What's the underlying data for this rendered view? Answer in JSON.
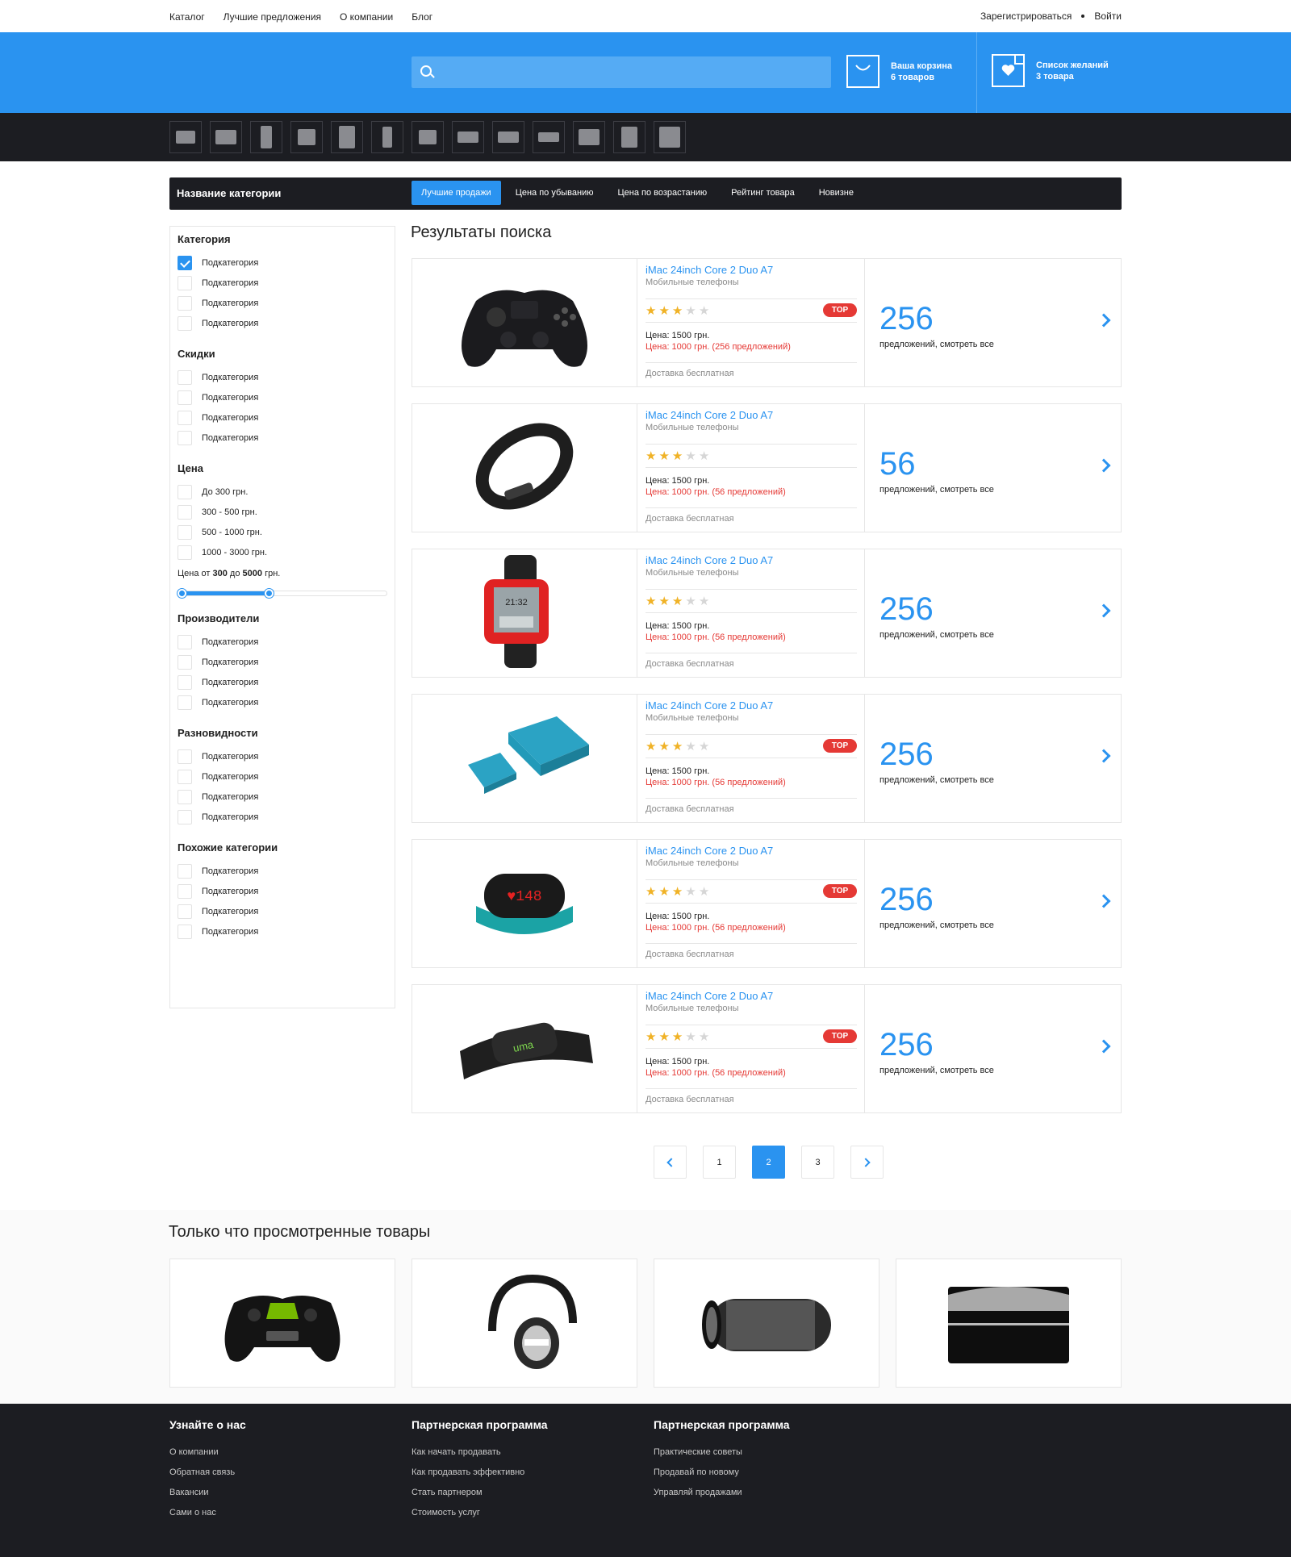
{
  "topnav": {
    "links": [
      "Каталог",
      "Лучшие предложения",
      "О компании",
      "Блог"
    ],
    "register": "Зарегистрироваться",
    "login": "Войти"
  },
  "header": {
    "search": {
      "value": "",
      "placeholder": ""
    },
    "cart": {
      "title": "Ваша корзина",
      "count": "6 товаров"
    },
    "wishlist": {
      "title": "Список желаний",
      "count": "3 товара"
    }
  },
  "categories": [
    "camera",
    "monitor",
    "fridge",
    "washbasin",
    "wardrobe",
    "bottle",
    "printer",
    "gamepad",
    "car",
    "router",
    "piano",
    "kitchenware",
    "books"
  ],
  "sortbar": {
    "title": "Название категории",
    "tabs": [
      "Лучшие продажи",
      "Цена по убыванию",
      "Цена по возрастанию",
      "Рейтинг товара",
      "Новизне"
    ],
    "active_tab": 0
  },
  "filters": {
    "groups": [
      {
        "title": "Категория",
        "items": [
          {
            "label": "Подкатегория",
            "checked": true
          },
          {
            "label": "Подкатегория",
            "checked": false
          },
          {
            "label": "Подкатегория",
            "checked": false
          },
          {
            "label": "Подкатегория",
            "checked": false
          }
        ]
      },
      {
        "title": "Скидки",
        "items": [
          {
            "label": "Подкатегория",
            "checked": false
          },
          {
            "label": "Подкатегория",
            "checked": false
          },
          {
            "label": "Подкатегория",
            "checked": false
          },
          {
            "label": "Подкатегория",
            "checked": false
          }
        ]
      },
      {
        "title": "Цена",
        "items": [
          {
            "label": "До 300 грн.",
            "checked": false
          },
          {
            "label": "300 - 500 грн.",
            "checked": false
          },
          {
            "label": "500 - 1000 грн.",
            "checked": false
          },
          {
            "label": "1000 - 3000 грн.",
            "checked": false
          }
        ],
        "range": {
          "prefix": "Цена от",
          "from": "300",
          "mid": "до",
          "to": "5000",
          "suffix": "грн.",
          "from_frac": 0.0,
          "to_frac": 0.42
        }
      },
      {
        "title": "Производители",
        "items": [
          {
            "label": "Подкатегория",
            "checked": false
          },
          {
            "label": "Подкатегория",
            "checked": false
          },
          {
            "label": "Подкатегория",
            "checked": false
          },
          {
            "label": "Подкатегория",
            "checked": false
          }
        ]
      },
      {
        "title": "Разновидности",
        "items": [
          {
            "label": "Подкатегория",
            "checked": false
          },
          {
            "label": "Подкатегория",
            "checked": false
          },
          {
            "label": "Подкатегория",
            "checked": false
          },
          {
            "label": "Подкатегория",
            "checked": false
          }
        ]
      },
      {
        "title": "Похожие категории",
        "items": [
          {
            "label": "Подкатегория",
            "checked": false
          },
          {
            "label": "Подкатегория",
            "checked": false
          },
          {
            "label": "Подкатегория",
            "checked": false
          },
          {
            "label": "Подкатегория",
            "checked": false
          }
        ]
      }
    ]
  },
  "results": {
    "title": "Результаты поиска",
    "items": [
      {
        "image": "gamepad-image",
        "name": "iMac 24inch Core 2 Duo A7",
        "category": "Мобильные телефоны",
        "rating": 3,
        "max_rating": 5,
        "top": true,
        "top_label": "TOP",
        "price": "Цена: 1500 грн.",
        "price_offer": "Цена: 1000 грн. (256 предложений)",
        "delivery": "Доставка бесплатная",
        "offers_count": "256",
        "offers_label": "предложений, смотреть все"
      },
      {
        "image": "fitness-band-image",
        "name": "iMac 24inch Core 2 Duo A7",
        "category": "Мобильные телефоны",
        "rating": 3,
        "max_rating": 5,
        "top": false,
        "top_label": "TOP",
        "price": "Цена: 1500 грн.",
        "price_offer": "Цена: 1000 грн. (56 предложений)",
        "delivery": "Доставка бесплатная",
        "offers_count": "56",
        "offers_label": "предложений, смотреть все"
      },
      {
        "image": "smartwatch-image",
        "name": "iMac 24inch Core 2 Duo A7",
        "category": "Мобильные телефоны",
        "rating": 3,
        "max_rating": 5,
        "top": false,
        "top_label": "TOP",
        "price": "Цена: 1500 грн.",
        "price_offer": "Цена: 1000 грн. (56 предложений)",
        "delivery": "Доставка бесплатная",
        "offers_count": "256",
        "offers_label": "предложений, смотреть все"
      },
      {
        "image": "usb-device-image",
        "name": "iMac 24inch Core 2 Duo A7",
        "category": "Мобильные телефоны",
        "rating": 3,
        "max_rating": 5,
        "top": true,
        "top_label": "TOP",
        "price": "Цена: 1500 грн.",
        "price_offer": "Цена: 1000 грн. (56 предложений)",
        "delivery": "Доставка бесплатная",
        "offers_count": "256",
        "offers_label": "предложений, смотреть все"
      },
      {
        "image": "heart-rate-band-image",
        "name": "iMac 24inch Core 2 Duo A7",
        "category": "Мобильные телефоны",
        "rating": 3,
        "max_rating": 5,
        "top": true,
        "top_label": "TOP",
        "price": "Цена: 1500 грн.",
        "price_offer": "Цена: 1000 грн. (56 предложений)",
        "delivery": "Доставка бесплатная",
        "offers_count": "256",
        "offers_label": "предложений, смотреть все"
      },
      {
        "image": "chest-strap-image",
        "name": "iMac 24inch Core 2 Duo A7",
        "category": "Мобильные телефоны",
        "rating": 3,
        "max_rating": 5,
        "top": true,
        "top_label": "TOP",
        "price": "Цена: 1500 грн.",
        "price_offer": "Цена: 1000 грн. (56 предложений)",
        "delivery": "Доставка бесплатная",
        "offers_count": "256",
        "offers_label": "предложений, смотреть все"
      }
    ]
  },
  "pagination": {
    "pages": [
      "1",
      "2",
      "3"
    ],
    "current": "2"
  },
  "recent": {
    "title": "Только что просмотренные товары",
    "items": [
      "shield-controller-image",
      "headphones-image",
      "speaker-image",
      "soundbar-image"
    ]
  },
  "footer": {
    "columns": [
      {
        "title": "Узнайте о нас",
        "links": [
          "О компании",
          "Обратная связь",
          "Вакансии",
          "Сами о нас"
        ]
      },
      {
        "title": "Партнерская программа",
        "links": [
          "Как начать продавать",
          "Как продавать эффективно",
          "Стать партнером",
          "Стоимость услуг"
        ]
      },
      {
        "title": "Партнерская программа",
        "links": [
          "Практические советы",
          "Продавай по новому",
          "Управляй продажами"
        ]
      }
    ]
  },
  "colors": {
    "accent": "#2a93f0",
    "dark": "#1c1d22",
    "red": "#e53935",
    "star": "#f0b226"
  }
}
